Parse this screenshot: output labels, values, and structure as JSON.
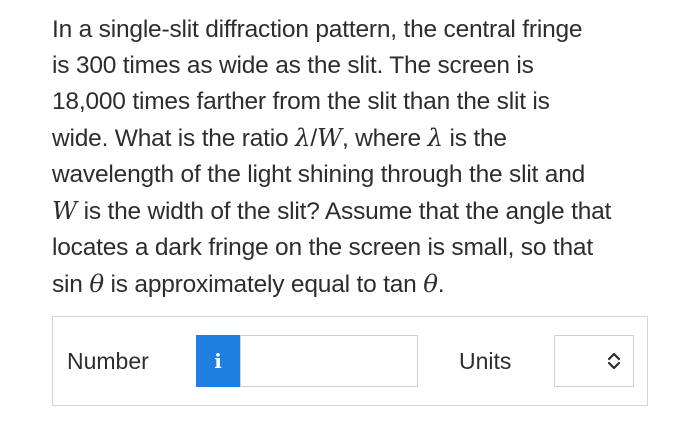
{
  "question": {
    "lines": [
      [
        "In a single-slit diffraction pattern, the central fringe"
      ],
      [
        "is 300 times as wide as the slit. The screen is"
      ],
      [
        "18,000 times farther from the slit than the slit is"
      ],
      [
        "wide. What is the ratio ",
        "λ",
        "/",
        "W",
        ", where ",
        "λ",
        " is the"
      ],
      [
        "wavelength of the light shining through the slit and"
      ],
      [
        "W",
        " is the width of the slit? Assume that the angle that"
      ],
      [
        "locates a dark fringe on the screen is small, so that"
      ],
      [
        "sin ",
        "θ",
        " is approximately equal to tan ",
        "θ",
        "."
      ]
    ]
  },
  "answer": {
    "number_label": "Number",
    "info_icon": "i",
    "number_value": "",
    "units_label": "Units",
    "units_value": "",
    "units_icon": "up-down-chevron-icon"
  },
  "colors": {
    "info_button": "#1f7fe0",
    "border": "#d6d6d6",
    "text": "#2d2d2d"
  }
}
